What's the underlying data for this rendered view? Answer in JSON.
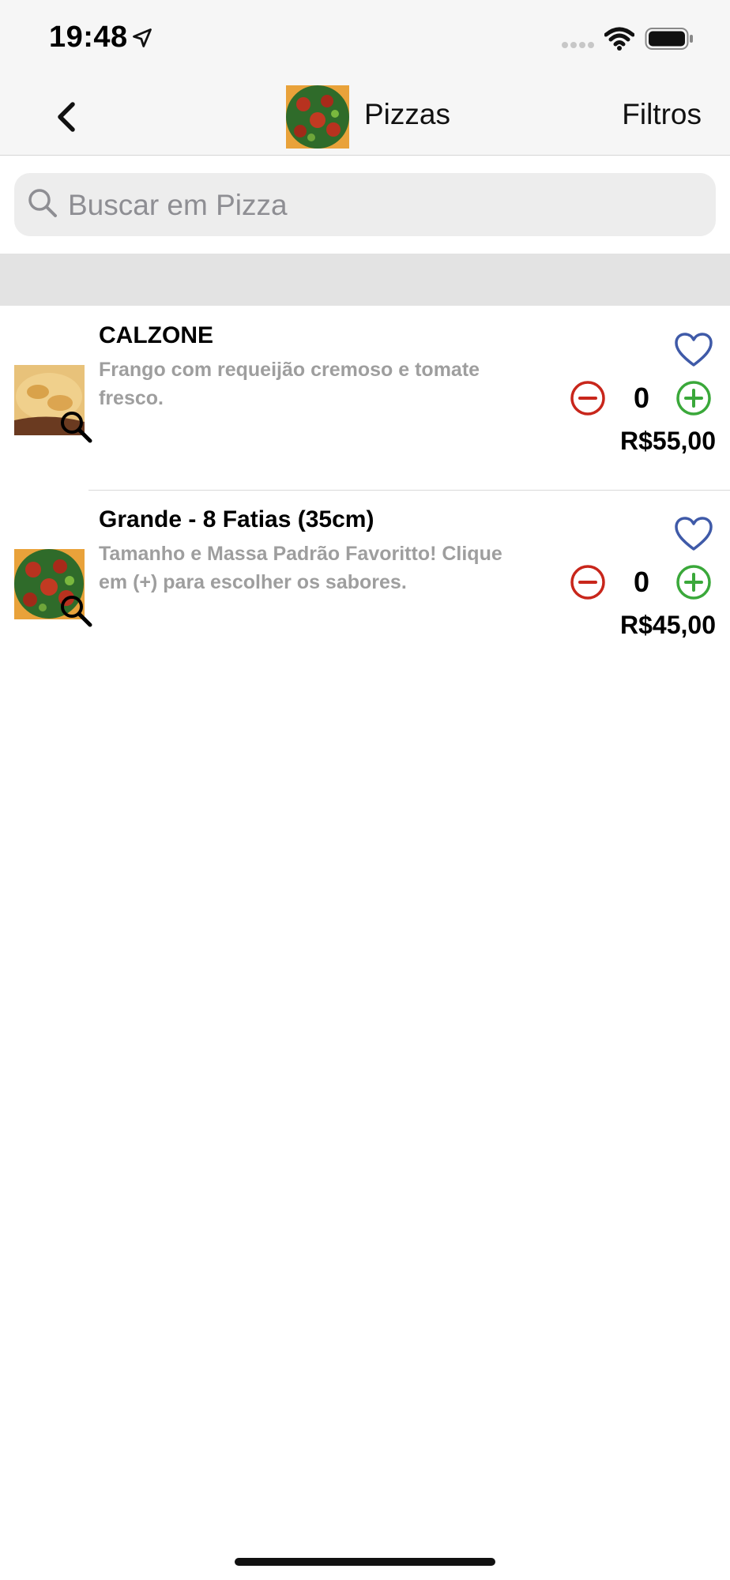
{
  "status_bar": {
    "time": "19:48",
    "icons": [
      "location-arrow-icon",
      "signal-icon",
      "wifi-icon",
      "battery-icon"
    ]
  },
  "nav": {
    "back_icon": "chevron-left-icon",
    "title": "Pizzas",
    "filters_label": "Filtros"
  },
  "search": {
    "placeholder": "Buscar em Pizza",
    "value": ""
  },
  "products": [
    {
      "title": "CALZONE",
      "description": "Frango com requeijão cremoso e tomate fresco.",
      "quantity": "0",
      "price": "R$55,00",
      "favorite": false
    },
    {
      "title": "Grande - 8 Fatias (35cm)",
      "description": "Tamanho e Massa Padrão Favoritto! Clique em (+) para escolher os sabores.",
      "quantity": "0",
      "price": "R$45,00",
      "favorite": false
    }
  ],
  "colors": {
    "heart": "#3f5aa8",
    "minus": "#c8261b",
    "plus": "#3aa83a",
    "section_header": "#e3e3e3",
    "bar_background": "#f6f6f6"
  }
}
